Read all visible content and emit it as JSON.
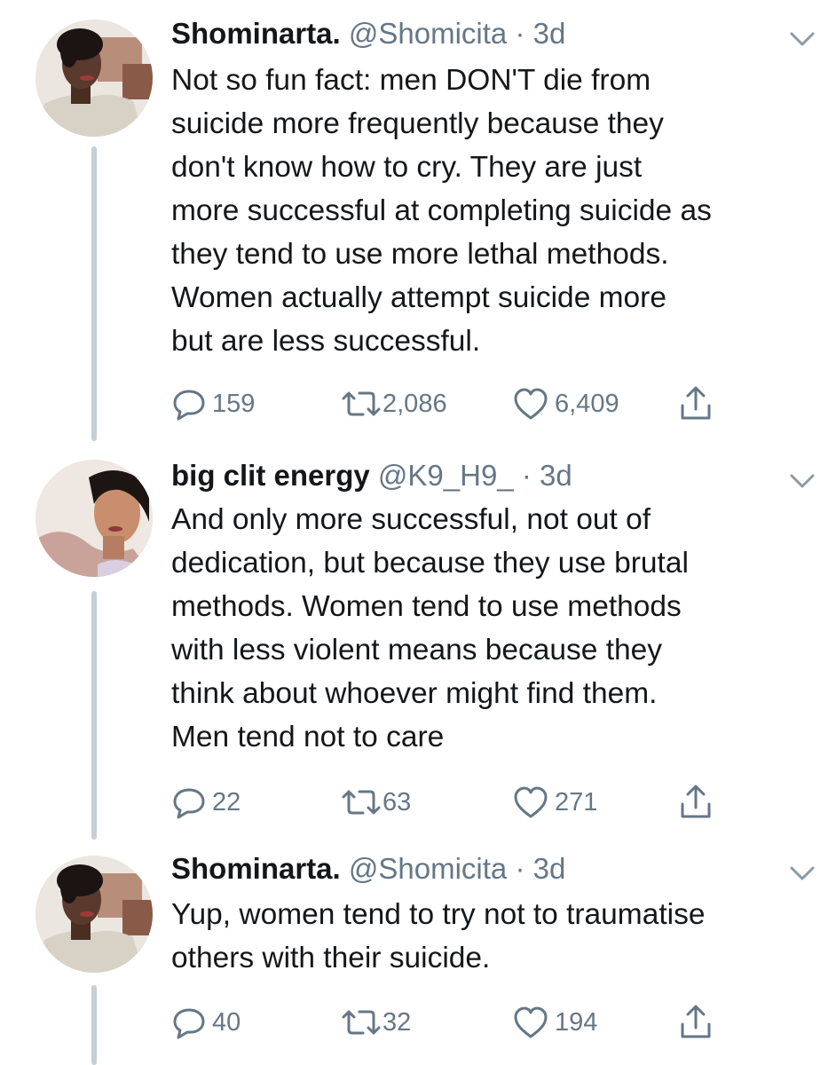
{
  "tweets": [
    {
      "name": "Shominarta.",
      "handle": "@Shomicita",
      "separator": "·",
      "time": "3d",
      "text": "Not so fun fact: men DON'T die from\nsuicide more frequently because they\ndon't know how to cry. They are just\nmore successful at completing suicide as\nthey tend to use more lethal methods.\nWomen actually attempt suicide more\nbut are less successful.",
      "replies": "159",
      "retweets": "2,086",
      "likes": "6,409"
    },
    {
      "name": "big clit energy",
      "handle": "@K9_H9_",
      "separator": "·",
      "time": "3d",
      "text": "And only more successful, not out of\ndedication, but because they use brutal\nmethods. Women tend to use methods\nwith less violent means because they\nthink about whoever might find them.\nMen tend not to care",
      "replies": "22",
      "retweets": "63",
      "likes": "271"
    },
    {
      "name": "Shominarta.",
      "handle": "@Shomicita",
      "separator": "·",
      "time": "3d",
      "text": "Yup, women tend to try not to traumatise\nothers with their suicide.",
      "replies": "40",
      "retweets": "32",
      "likes": "194"
    }
  ],
  "icons": {
    "reply": "reply-icon",
    "retweet": "retweet-icon",
    "like": "heart-icon",
    "share": "share-icon",
    "menu": "chevron-down-icon"
  },
  "colors": {
    "text": "#14171a",
    "secondary": "#657786",
    "thread_line": "#c4cfd6"
  }
}
